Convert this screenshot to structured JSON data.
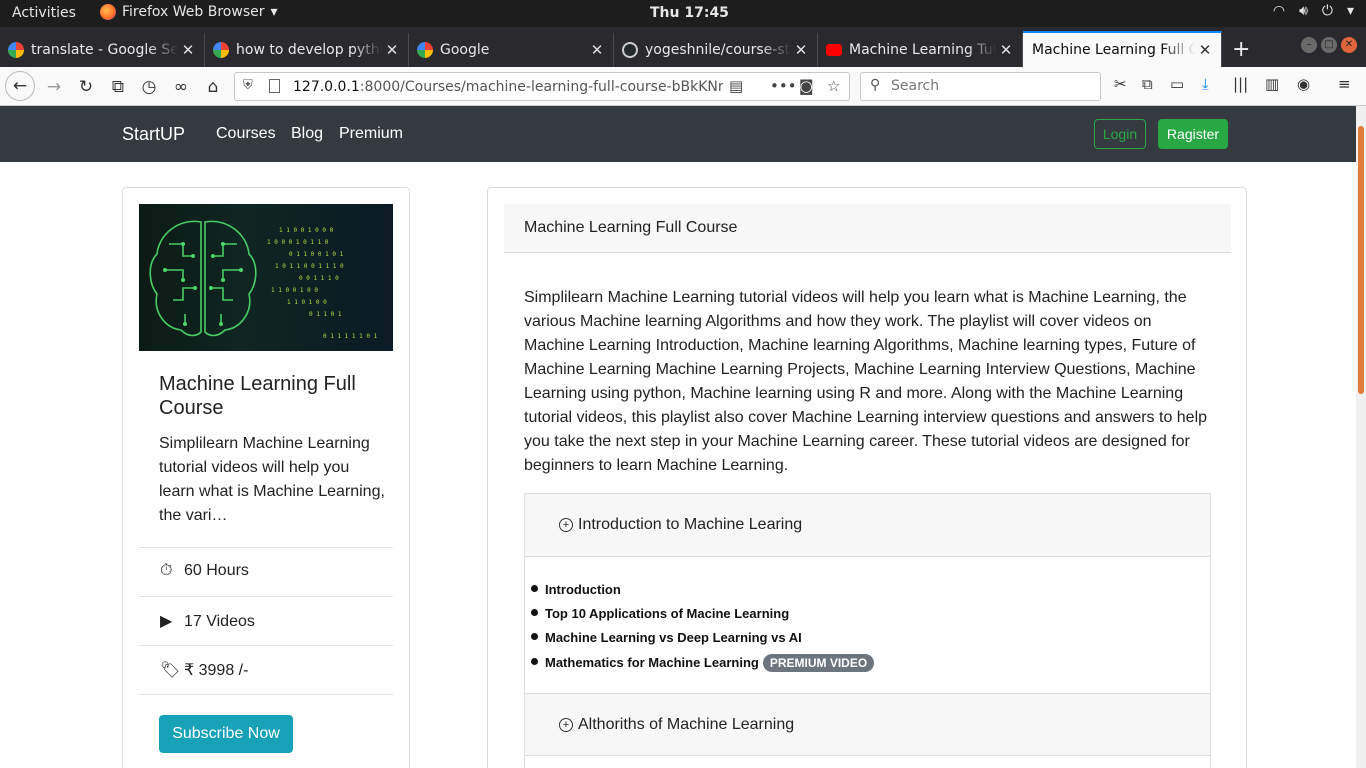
{
  "system": {
    "activities": "Activities",
    "app_menu": "Firefox Web Browser",
    "clock": "Thu 17:45"
  },
  "tabs": [
    {
      "title": "translate - Google Search",
      "icon": "google-icon"
    },
    {
      "title": "how to develop python",
      "icon": "google-icon"
    },
    {
      "title": "Google",
      "icon": "google-icon"
    },
    {
      "title": "yogeshnile/course-str",
      "icon": "github-icon"
    },
    {
      "title": "Machine Learning Tut",
      "icon": "youtube-icon"
    },
    {
      "title": "Machine Learning Full Course",
      "icon": "none",
      "active": true
    }
  ],
  "browser": {
    "url_host": "127.0.0.1",
    "url_path": ":8000/Courses/machine-learning-full-course-bBkKNr",
    "search_placeholder": "Search",
    "accent_color": "#0a84ff"
  },
  "site": {
    "brand": "StartUP",
    "nav": [
      "Courses",
      "Blog",
      "Premium"
    ],
    "login": "Login",
    "register": "Ragister",
    "nav_bg": "#343a40",
    "green": "#28a745"
  },
  "course_card": {
    "title": "Machine Learning Full Course",
    "desc": "Simplilearn Machine Learning tutorial videos will help you learn what is Machine Learning, the vari…",
    "duration": "60 Hours",
    "videos": "17 Videos",
    "price": "₹ 3998 /-",
    "subscribe": "Subscribe Now"
  },
  "detail": {
    "header": "Machine Learning Full Course",
    "desc": "Simplilearn Machine Learning tutorial videos will help you learn what is Machine Learning, the various Machine learning Algorithms and how they work. The playlist will cover videos on Machine Learning Introduction, Machine learning Algorithms, Machine learning types, Future of Machine Learning Machine Learning Projects, Machine Learning Interview Questions, Machine Learning using python, Machine learning using R and more. Along with the Machine Learning tutorial videos, this playlist also cover Machine Learning interview questions and answers to help you take the next step in your Machine Learning career. These tutorial videos are designed for beginners to learn Machine Learning.",
    "sections": [
      {
        "title": "Introduction to Machine Learing",
        "lessons": [
          {
            "title": "Introduction"
          },
          {
            "title": "Top 10 Applications of Macine Learning"
          },
          {
            "title": "Machine Learning vs Deep Learning vs AI"
          },
          {
            "title": "Mathematics for Machine Learning",
            "badge": "PREMIUM VIDEO"
          }
        ]
      },
      {
        "title": "Althoriths of Machine Learning"
      }
    ]
  }
}
